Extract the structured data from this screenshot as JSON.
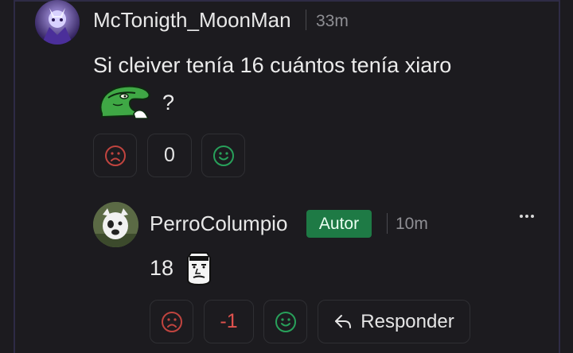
{
  "comment": {
    "username": "McTonigth_MoonMan",
    "time": "33m",
    "text": "Si cleiver tenía 16 cuántos tenía xiaro",
    "trailing": "?",
    "score": "0",
    "emote": "green-dinosaur-emote",
    "icons": {
      "downvote": "frown-icon",
      "upvote": "smile-icon"
    }
  },
  "reply": {
    "username": "PerroColumpio",
    "badge": "Autor",
    "time": "10m",
    "text": "18",
    "score": "-1",
    "reply_label": "Responder",
    "emote": "face-sticker-emote",
    "icons": {
      "downvote": "frown-icon",
      "upvote": "smile-icon",
      "reply": "reply-arrow-icon",
      "more": "more-dots-icon"
    }
  },
  "colors": {
    "background": "#1c1b1f",
    "frame_border": "#2e2b45",
    "badge_bg": "#1e7a45",
    "downvote": "#c0443f",
    "upvote": "#28a05a",
    "negative_score": "#e0524e",
    "muted_text": "#8e8e93"
  }
}
